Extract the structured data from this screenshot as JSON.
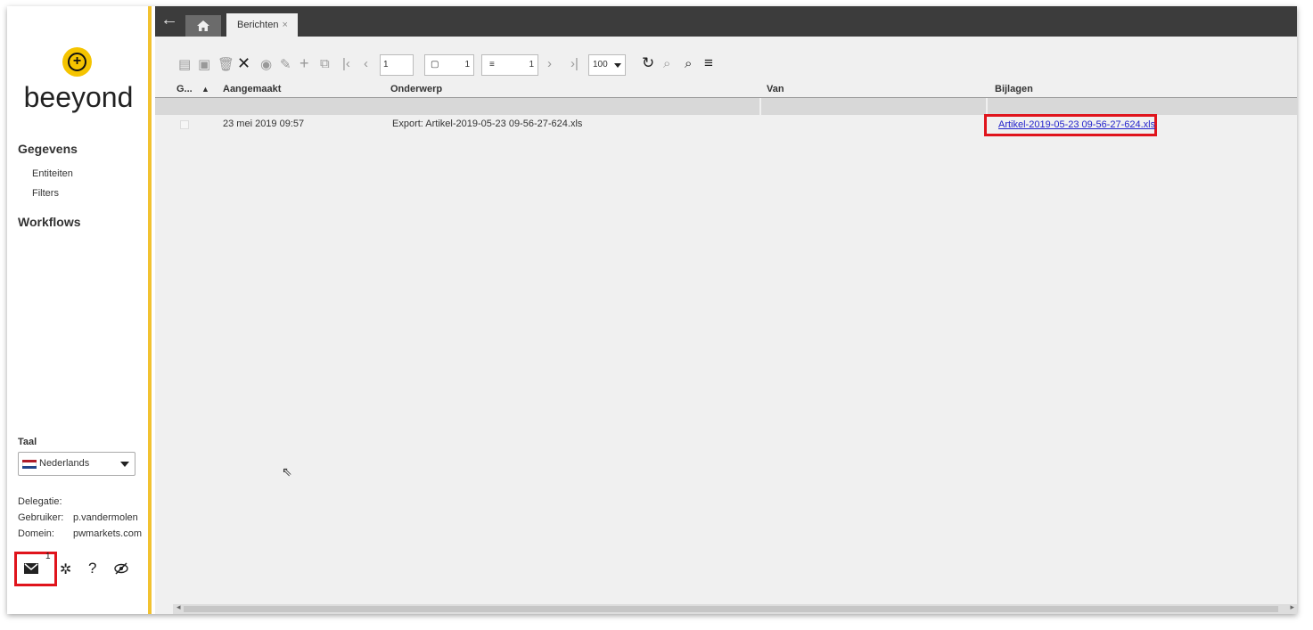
{
  "sidebar": {
    "logo_text": "beeyond",
    "sections": [
      {
        "label": "Gegevens",
        "items": [
          "Entiteiten",
          "Filters"
        ]
      },
      {
        "label": "Workflows",
        "items": []
      }
    ],
    "language": {
      "label": "Taal",
      "value": "Nederlands",
      "flag_colors": [
        "#ae1c28",
        "#ffffff",
        "#21468b"
      ]
    },
    "info": {
      "delegatie_label": "Delegatie:",
      "gebruiker_label": "Gebruiker:",
      "gebruiker_value": "p.vandermolen",
      "domein_label": "Domein:",
      "domein_value": "pwmarkets.com"
    },
    "bottom_icons": {
      "mail_count": "1",
      "help": "?"
    }
  },
  "tabs": {
    "home_icon": "home-icon",
    "active_tab": "Berichten",
    "close": "×"
  },
  "toolbar": {
    "page_input": "1",
    "pages_count": "1",
    "rows_count": "1",
    "page_size": "100"
  },
  "grid": {
    "columns": [
      "G...",
      "Aangemaakt",
      "Onderwerp",
      "Van",
      "Bijlagen"
    ],
    "sort_indicator": "▲",
    "rows": [
      {
        "aangemaakt": "23 mei 2019 09:57",
        "onderwerp": "Export: Artikel-2019-05-23 09-56-27-624.xls",
        "van": "",
        "bijlagen": "Artikel-2019-05-23 09-56-27-624.xls"
      }
    ]
  },
  "colors": {
    "accent": "#f2c230",
    "highlight": "#e0141c",
    "link": "#2222cc",
    "topbar": "#3c3c3c"
  }
}
